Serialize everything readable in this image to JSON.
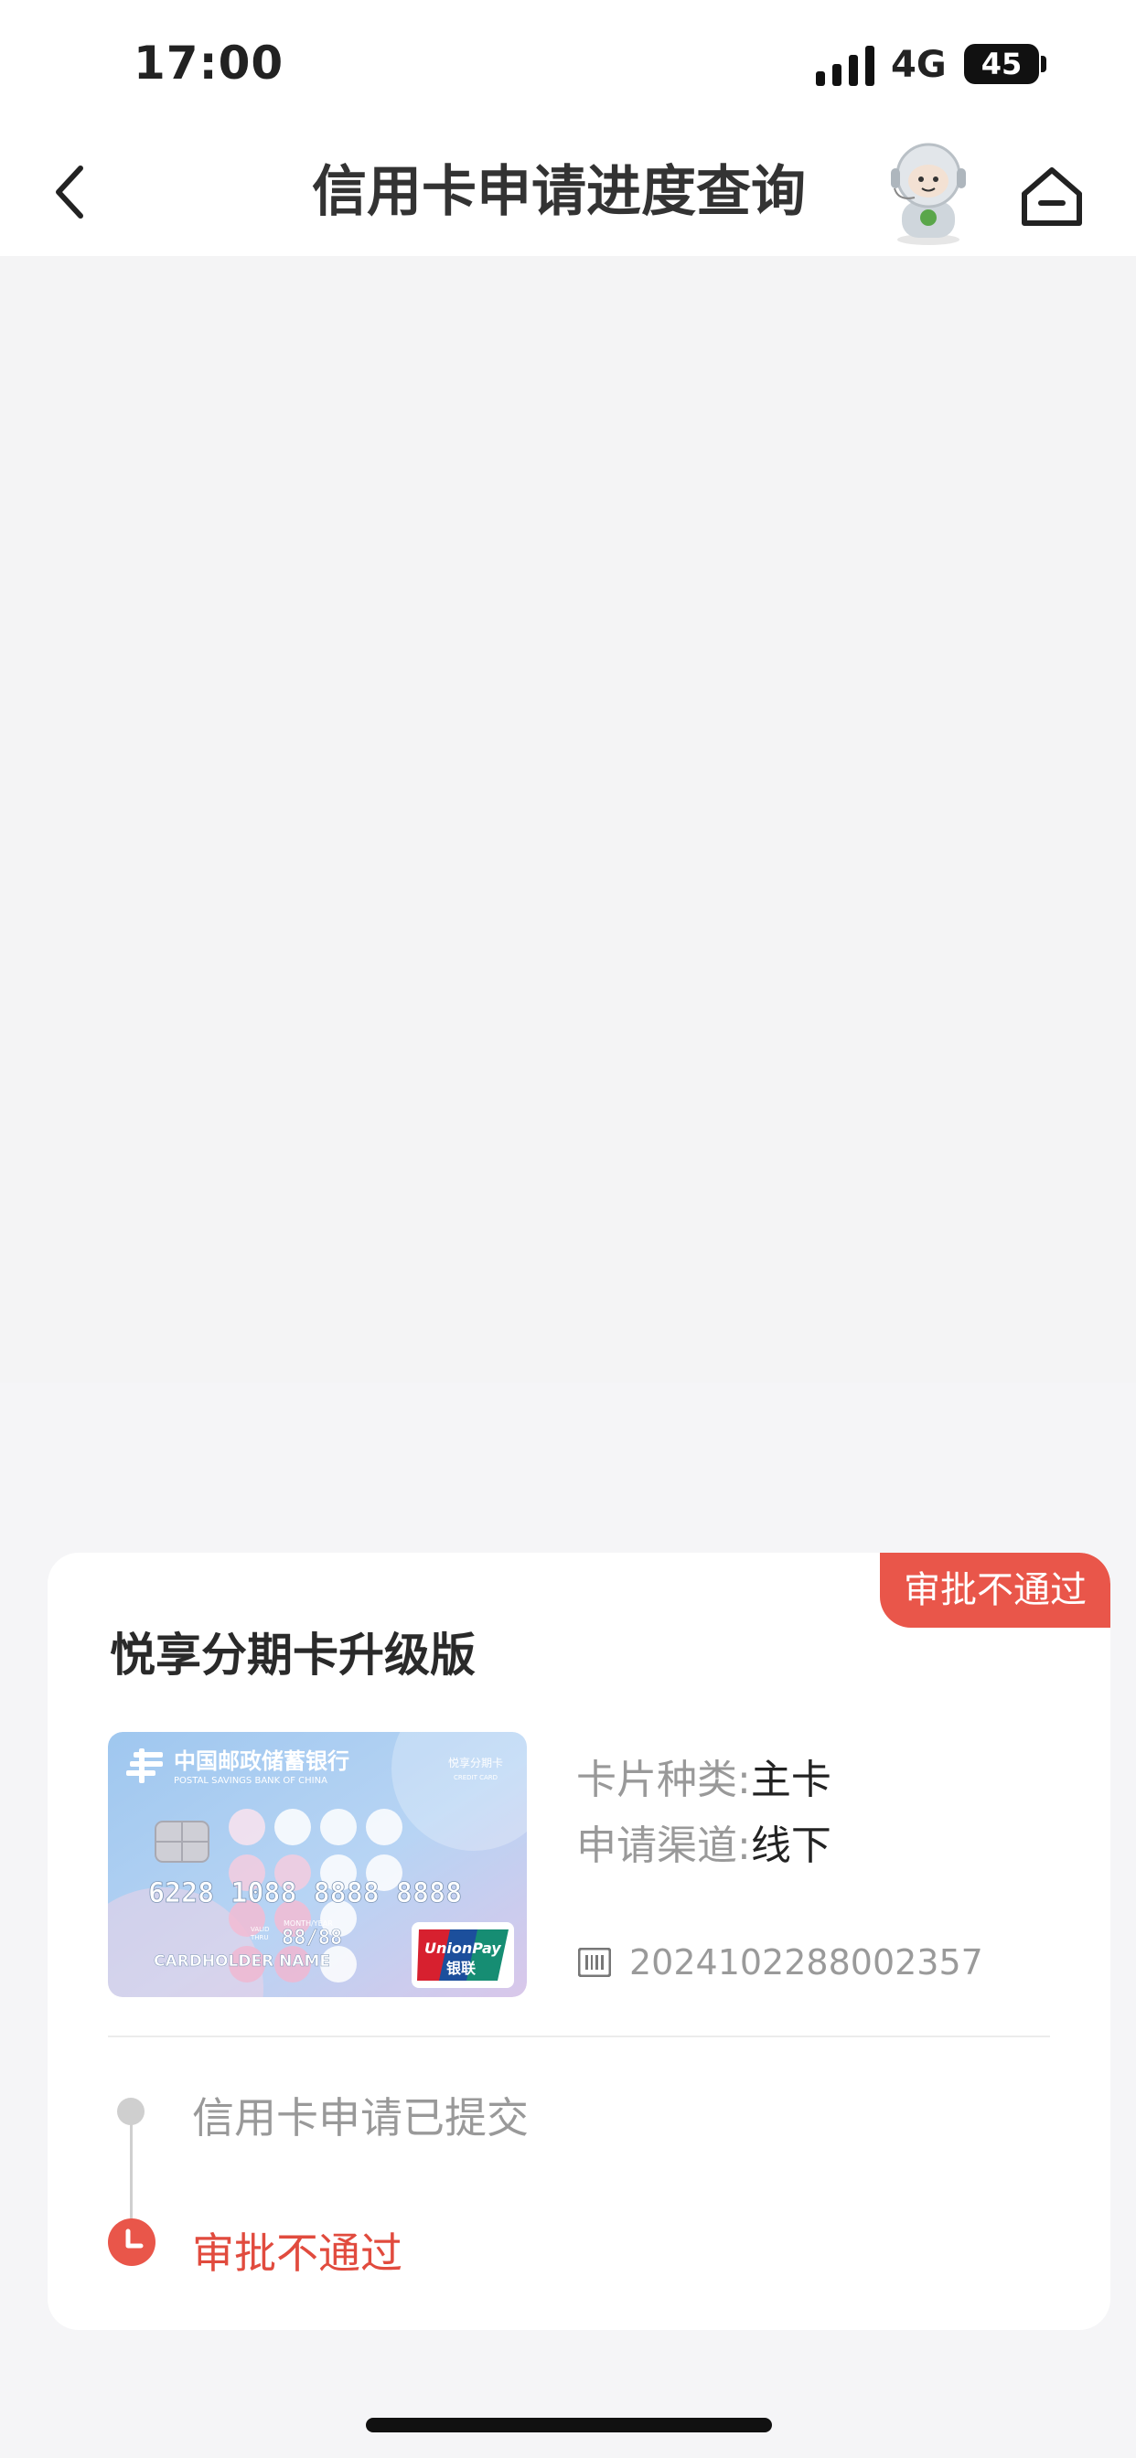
{
  "status_bar": {
    "time": "17:00",
    "network": "4G",
    "battery": "45"
  },
  "header": {
    "title": "信用卡申请进度查询",
    "back_icon": "chevron-left-icon",
    "assistant_icon": "robot-assistant-avatar",
    "home_icon": "home-icon"
  },
  "application": {
    "status_badge": "审批不通过",
    "product_name": "悦享分期卡升级版",
    "card_image": {
      "bank_name_cn": "中国邮政储蓄银行",
      "bank_name_en": "POSTAL SAVINGS BANK OF CHINA",
      "card_label": "悦享分期卡",
      "card_label_en": "CREDIT CARD",
      "card_number": "6228 1088 8888 8888",
      "valid_label_1": "VALID",
      "valid_label_2": "THRU",
      "expiry_caption": "MONTH/YEAR",
      "expiry": "88/88",
      "holder": "CARDHOLDER NAME",
      "network_en": "UnionPay",
      "network_cn": "银联"
    },
    "card_type_label": "卡片种类:",
    "card_type_value": "主卡",
    "channel_label": "申请渠道:",
    "channel_value": "线下",
    "application_number": "2024102288002357",
    "steps": [
      {
        "label": "信用卡申请已提交",
        "state": "done"
      },
      {
        "label": "审批不通过",
        "state": "rejected"
      }
    ]
  },
  "colors": {
    "accent_red": "#e9564a",
    "step_gray": "#cfcfcf",
    "background": "#f4f4f5"
  }
}
